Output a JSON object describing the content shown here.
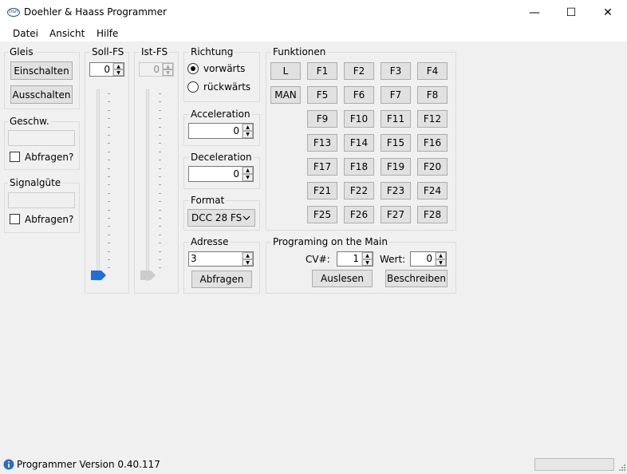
{
  "window": {
    "title": "Doehler & Haass Programmer",
    "icon_text": "D&H",
    "minimize": "—",
    "maximize": "☐",
    "close": "✕"
  },
  "menu": {
    "items": [
      "Datei",
      "Ansicht",
      "Hilfe"
    ]
  },
  "gleis": {
    "label": "Gleis",
    "on_button": "Einschalten",
    "off_button": "Ausschalten"
  },
  "geschw": {
    "label": "Geschw.",
    "value": "",
    "query_label": "Abfragen?",
    "query_checked": false
  },
  "signal": {
    "label": "Signalgüte",
    "value": "",
    "query_label": "Abfragen?",
    "query_checked": false
  },
  "soll": {
    "label": "Soll-FS",
    "value": "0",
    "slider_fraction": 0
  },
  "ist": {
    "label": "Ist-FS",
    "value": "0",
    "slider_fraction": 0
  },
  "richtung": {
    "label": "Richtung",
    "forward": "vorwärts",
    "backward": "rückwärts",
    "selected": "forward"
  },
  "acceleration": {
    "label": "Acceleration",
    "value": "0"
  },
  "deceleration": {
    "label": "Deceleration",
    "value": "0"
  },
  "format": {
    "label": "Format",
    "value": "DCC 28 FS"
  },
  "adresse": {
    "label": "Adresse",
    "value": "3",
    "query_button": "Abfragen"
  },
  "funktionen": {
    "label": "Funktionen",
    "light": "L",
    "manual": "MAN",
    "buttons": [
      "F1",
      "F2",
      "F3",
      "F4",
      "F5",
      "F6",
      "F7",
      "F8",
      "F9",
      "F10",
      "F11",
      "F12",
      "F13",
      "F14",
      "F15",
      "F16",
      "F17",
      "F18",
      "F19",
      "F20",
      "F21",
      "F22",
      "F23",
      "F24",
      "F25",
      "F26",
      "F27",
      "F28"
    ]
  },
  "pom": {
    "label": "Programing on the Main",
    "cv_label": "CV#:",
    "cv_value": "1",
    "wert_label": "Wert:",
    "wert_value": "0",
    "read_button": "Auslesen",
    "write_button": "Beschreiben"
  },
  "status": {
    "text": "Programmer Version 0.40.117",
    "progress": 0
  },
  "colors": {
    "accent": "#1e6fd9",
    "window_bg": "#f0f0f0"
  }
}
